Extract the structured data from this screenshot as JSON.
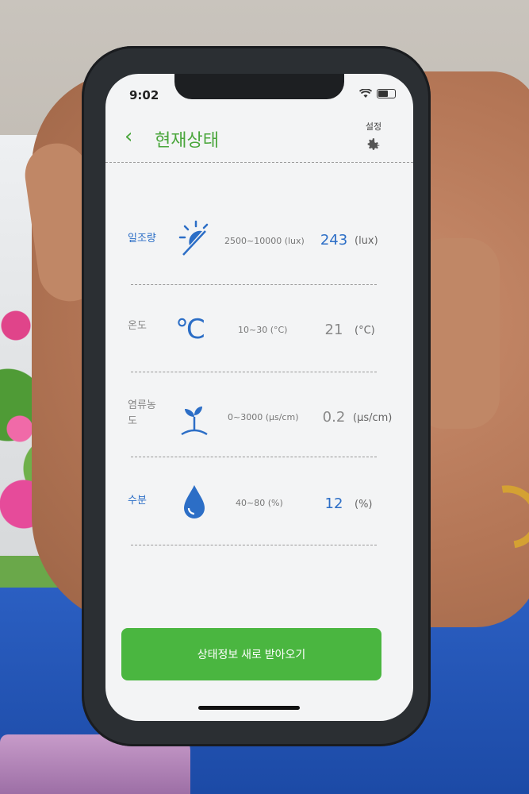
{
  "status_bar": {
    "time": "9:02"
  },
  "header": {
    "title": "현재상태",
    "back_glyph": "‹",
    "settings_label": "설정"
  },
  "rows": [
    {
      "label": "일조량",
      "icon": "sun-icon",
      "range": "2500~10000 (lux)",
      "value": "243",
      "unit": "(lux)",
      "color": "#2c6ec6"
    },
    {
      "label": "온도",
      "icon": "celsius-icon",
      "range": "10~30 (°C)",
      "value": "21",
      "unit": "(°C)",
      "color": "#888888"
    },
    {
      "label": "염류농도",
      "icon": "sprout-icon",
      "range": "0~3000 (μs/cm)",
      "value": "0.2",
      "unit": "(μs/cm)",
      "color": "#888888"
    },
    {
      "label": "수분",
      "icon": "water-drop-icon",
      "range": "40~80 (%)",
      "value": "12",
      "unit": "(%)",
      "color": "#2c6ec6"
    }
  ],
  "refresh_button": {
    "label": "상태정보 새로 받아오기"
  },
  "colors": {
    "accent_green": "#4aa63c",
    "button_green": "#4ab640",
    "value_blue": "#2c6ec6"
  }
}
